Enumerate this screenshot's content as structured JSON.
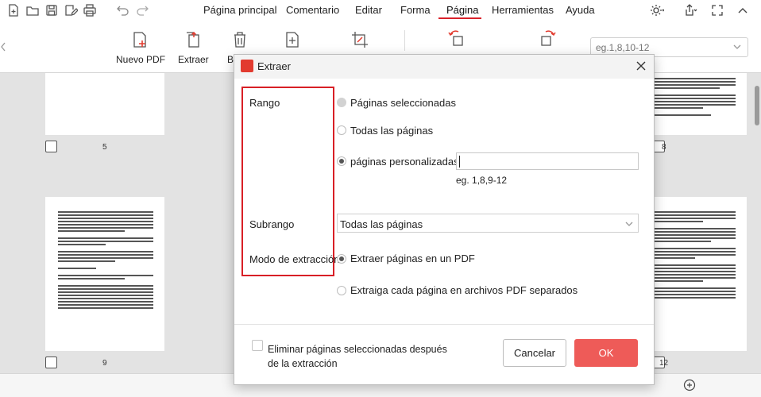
{
  "menu": {
    "items": [
      "Página principal",
      "Comentario",
      "Editar",
      "Forma",
      "Página",
      "Herramientas",
      "Ayuda"
    ],
    "active": "Página"
  },
  "ribbon": {
    "tools": [
      "Nuevo PDF",
      "Extraer",
      "B"
    ],
    "range_placeholder": "eg.1,8,10-12"
  },
  "thumbnails": {
    "page_numbers": [
      "5",
      "8",
      "9",
      "12"
    ]
  },
  "dialog": {
    "title": "Extraer",
    "range_label": "Rango",
    "range_options": [
      "Páginas seleccionadas",
      "Todas las páginas",
      "páginas personalizadas"
    ],
    "range_selected": "páginas personalizadas",
    "range_disabled": "Páginas seleccionadas",
    "custom_value": "",
    "custom_hint": "eg. 1,8,9-12",
    "subrange_label": "Subrango",
    "subrange_value": "Todas las páginas",
    "mode_label": "Modo de extracción",
    "mode_options": [
      "Extraer páginas en un PDF",
      "Extraiga cada página en archivos PDF separados"
    ],
    "mode_selected": "Extraer páginas en un PDF",
    "delete_label": "Eliminar páginas seleccionadas después de la extracción",
    "delete_checked": false,
    "cancel_label": "Cancelar",
    "ok_label": "OK"
  },
  "colors": {
    "accent": "#d9222a",
    "ok_button": "#ee5b58",
    "highlight_box": "#d81f26"
  },
  "icons": [
    "new-file-icon",
    "open-folder-icon",
    "save-icon",
    "edit-save-icon",
    "print-icon",
    "undo-icon",
    "redo-icon",
    "theme-sun-icon",
    "share-icon",
    "fullscreen-icon",
    "collapse-icon",
    "new-pdf-icon",
    "extract-icon",
    "delete-icon",
    "insert-page-icon",
    "crop-icon",
    "rotate-left-icon",
    "rotate-right-icon",
    "close-icon",
    "chevron-down-icon",
    "zoom-in-icon"
  ]
}
